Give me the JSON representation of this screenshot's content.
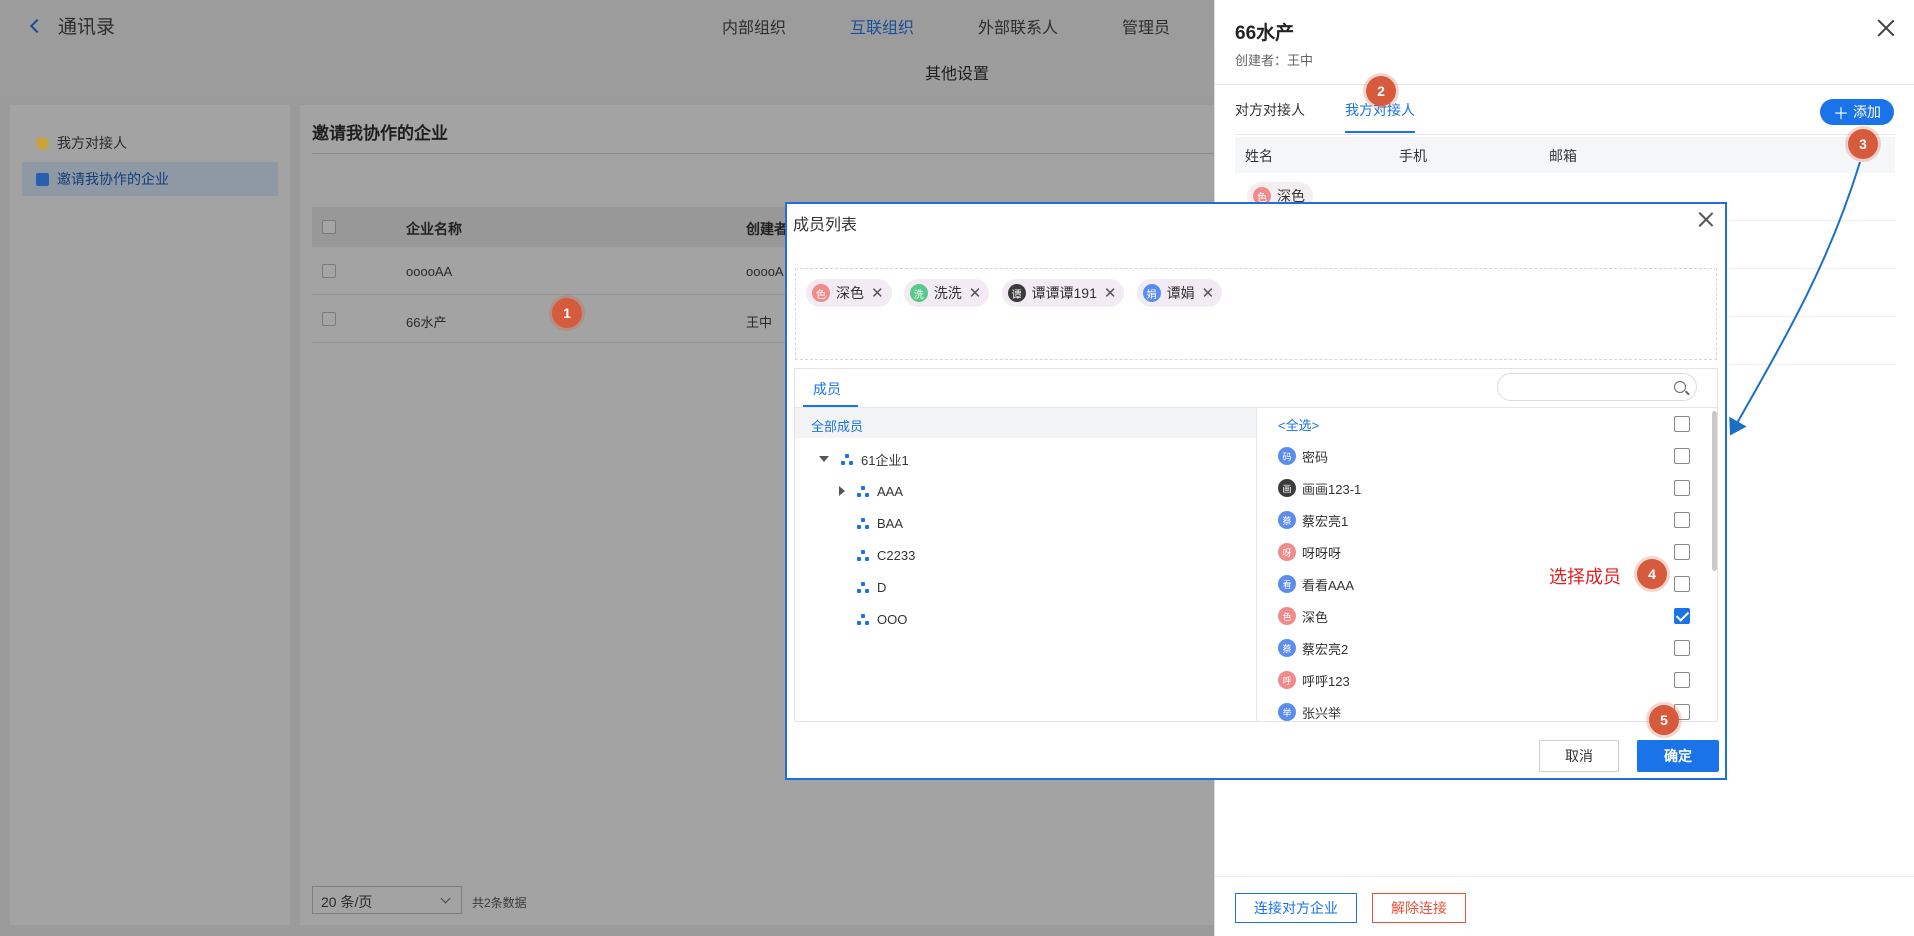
{
  "header": {
    "back_label": "通讯录",
    "nav": [
      "内部组织",
      "互联组织",
      "外部联系人",
      "管理员"
    ],
    "active_nav_index": 1
  },
  "subheader": {
    "title": "其他设置"
  },
  "sidebar": {
    "items": [
      {
        "label": "我方对接人"
      },
      {
        "label": "邀请我协作的企业"
      }
    ]
  },
  "main": {
    "title": "邀请我协作的企业",
    "columns": [
      "企业名称",
      "创建者"
    ],
    "rows": [
      {
        "name": "ooooAA",
        "creator": "ooooA"
      },
      {
        "name": "66水产",
        "creator": "王中"
      }
    ],
    "pager": {
      "page_size": "20 条/页",
      "total": "共2条数据"
    }
  },
  "drawer": {
    "title": "66水产",
    "subtitle": "创建者：王中",
    "tabs": [
      "对方对接人",
      "我方对接人"
    ],
    "active_tab": 1,
    "add_label": "添加",
    "columns": [
      "姓名",
      "手机",
      "邮箱"
    ],
    "rows": [
      {
        "name": "深色",
        "avatar": "色"
      }
    ],
    "connect_label": "连接对方企业",
    "disconnect_label": "解除连接"
  },
  "dialog": {
    "title": "成员列表",
    "selected_chips": [
      {
        "label": "深色",
        "avatar": "色",
        "color": "#f08b8b"
      },
      {
        "label": "洗洗",
        "avatar": "洗",
        "color": "#5bc98a"
      },
      {
        "label": "谭谭谭191",
        "avatar": "谭",
        "color": "#3b3b3b"
      },
      {
        "label": "谭娟",
        "avatar": "娟",
        "color": "#5b8def"
      }
    ],
    "tab": "成员",
    "search_placeholder": "",
    "tree_all": "全部成员",
    "tree": [
      {
        "label": "61企业1",
        "level": 0,
        "toggle": "expanded"
      },
      {
        "label": "AAA",
        "level": 1,
        "toggle": "collapsed"
      },
      {
        "label": "BAA",
        "level": 1,
        "toggle": "none"
      },
      {
        "label": "C2233",
        "level": 1,
        "toggle": "none"
      },
      {
        "label": "D",
        "level": 1,
        "toggle": "none"
      },
      {
        "label": "OOO",
        "level": 1,
        "toggle": "none"
      }
    ],
    "select_all": "<全选>",
    "members": [
      {
        "label": "密码",
        "avatar": "码",
        "color": "#5b8def",
        "checked": false
      },
      {
        "label": "画画123-1",
        "avatar": "画",
        "color": "#3b3b3b",
        "checked": false
      },
      {
        "label": "蔡宏亮1",
        "avatar": "蔡",
        "color": "#5b8def",
        "checked": false
      },
      {
        "label": "呀呀呀",
        "avatar": "呀",
        "color": "#f08b8b",
        "checked": false
      },
      {
        "label": "看看AAA",
        "avatar": "看",
        "color": "#5b8def",
        "checked": false
      },
      {
        "label": "深色",
        "avatar": "色",
        "color": "#f08b8b",
        "checked": true
      },
      {
        "label": "蔡宏亮2",
        "avatar": "蔡",
        "color": "#5b8def",
        "checked": false
      },
      {
        "label": "呼呼123",
        "avatar": "呼",
        "color": "#f08b8b",
        "checked": false
      },
      {
        "label": "张兴举",
        "avatar": "举",
        "color": "#5b8def",
        "checked": false
      }
    ],
    "cancel_label": "取消",
    "ok_label": "确定"
  },
  "annotations": {
    "steps": [
      "1",
      "2",
      "3",
      "4",
      "5"
    ],
    "select_member_label": "选择成员"
  },
  "colors": {
    "accent": "#1a73e8",
    "step": "#d65a3c",
    "danger": "#e5533d"
  }
}
